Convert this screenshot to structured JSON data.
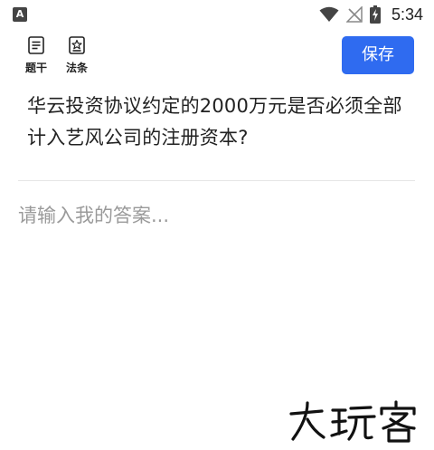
{
  "status_bar": {
    "time": "5:34",
    "left_icon": "app-notification-icon",
    "icons": [
      "wifi-icon",
      "no-signal-icon",
      "battery-charging-icon"
    ]
  },
  "toolbar": {
    "stem_label": "题干",
    "law_label": "法条",
    "save_label": "保存",
    "accent_color": "#2f6bf0"
  },
  "question": {
    "text": "华云投资协议约定的2000万元是否必须全部计入艺风公司的注册资本?"
  },
  "answer": {
    "placeholder": "请输入我的答案...",
    "value": ""
  },
  "watermark": {
    "text": "大玩客"
  }
}
